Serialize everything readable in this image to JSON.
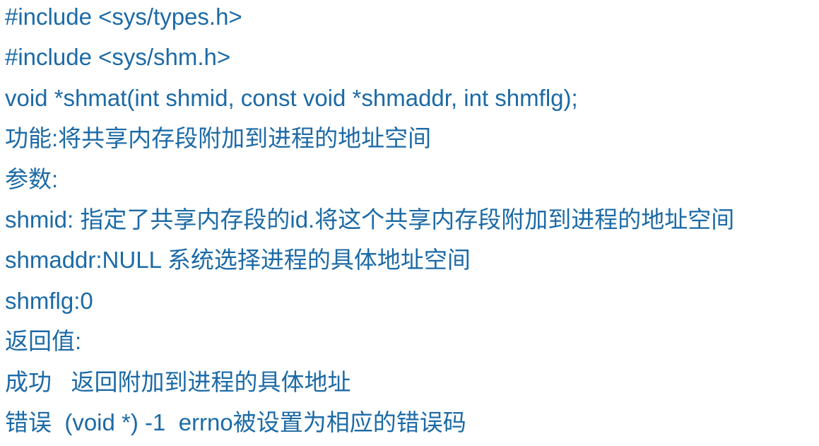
{
  "text_color": "#1c6aa6",
  "lines": [
    "#include <sys/types.h>",
    "#include <sys/shm.h>",
    "void *shmat(int shmid, const void *shmaddr, int shmflg);",
    "功能:将共享内存段附加到进程的地址空间",
    "参数:",
    "shmid: 指定了共享内存段的id.将这个共享内存段附加到进程的地址空间",
    "shmaddr:NULL 系统选择进程的具体地址空间",
    "shmflg:0",
    "返回值:",
    "成功   返回附加到进程的具体地址",
    "错误  (void *) -1  errno被设置为相应的错误码"
  ]
}
